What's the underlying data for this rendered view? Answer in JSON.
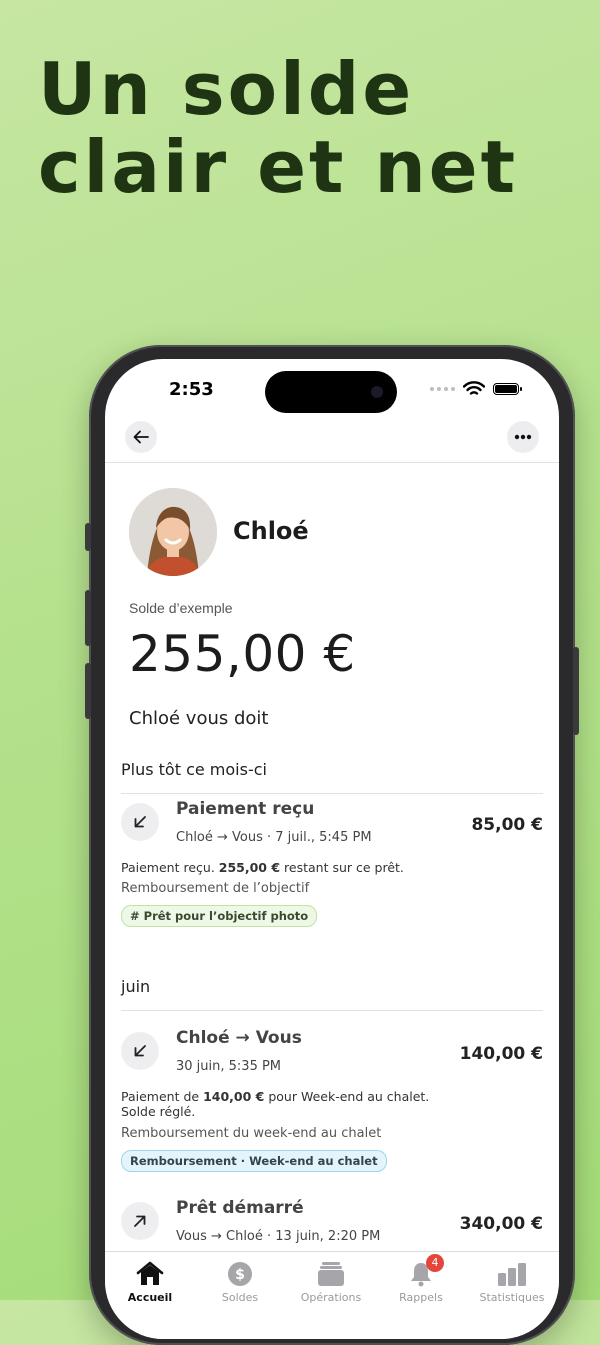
{
  "headline": {
    "line1": "Un solde",
    "line2": "clair et net"
  },
  "status_bar": {
    "time": "2:53"
  },
  "contact": {
    "name": "Chloé"
  },
  "balance": {
    "label": "Solde d’exemple",
    "amount": "255,00 €",
    "summary": "Chloé vous doit"
  },
  "sections": [
    {
      "title": "Plus tôt ce mois-ci"
    },
    {
      "title": "juin"
    }
  ],
  "transactions": [
    {
      "icon": "arrow-down-left-icon",
      "title": "Paiement reçu",
      "subtitle": "Chloé → Vous · 7 juil., 5:45 PM",
      "amount": "85,00 €",
      "desc_pre": "Paiement reçu. ",
      "desc_bold": "255,00 €",
      "desc_post": " restant sur ce prêt.",
      "desc_line2": "",
      "note": "Remboursement de l’objectif",
      "tag": "# Prêt pour l’objectif photo"
    },
    {
      "icon": "arrow-down-left-icon",
      "title": "Chloé → Vous",
      "subtitle": "30 juin, 5:35 PM",
      "amount": "140,00 €",
      "desc_pre": "Paiement de ",
      "desc_bold": "140,00 €",
      "desc_post": " pour Week-end au chalet.",
      "desc_line2": "Solde réglé.",
      "note": "Remboursement du week-end au chalet",
      "tag": "Remboursement · Week-end au chalet"
    },
    {
      "icon": "arrow-up-right-icon",
      "title": "Prêt démarré",
      "subtitle": "Vous → Chloé · 13 juin, 2:20 PM",
      "amount": "340,00 €"
    }
  ],
  "tabbar": {
    "items": [
      {
        "label": "Accueil",
        "icon": "home-icon",
        "active": true
      },
      {
        "label": "Soldes",
        "icon": "dollar-icon"
      },
      {
        "label": "Opérations",
        "icon": "stack-icon"
      },
      {
        "label": "Rappels",
        "icon": "bell-icon",
        "badge": "4"
      },
      {
        "label": "Statistiques",
        "icon": "bar-chart-icon"
      }
    ]
  },
  "colors": {
    "headline": "#1e3412",
    "badge": "#e5463c",
    "background": "#b4e18c"
  }
}
